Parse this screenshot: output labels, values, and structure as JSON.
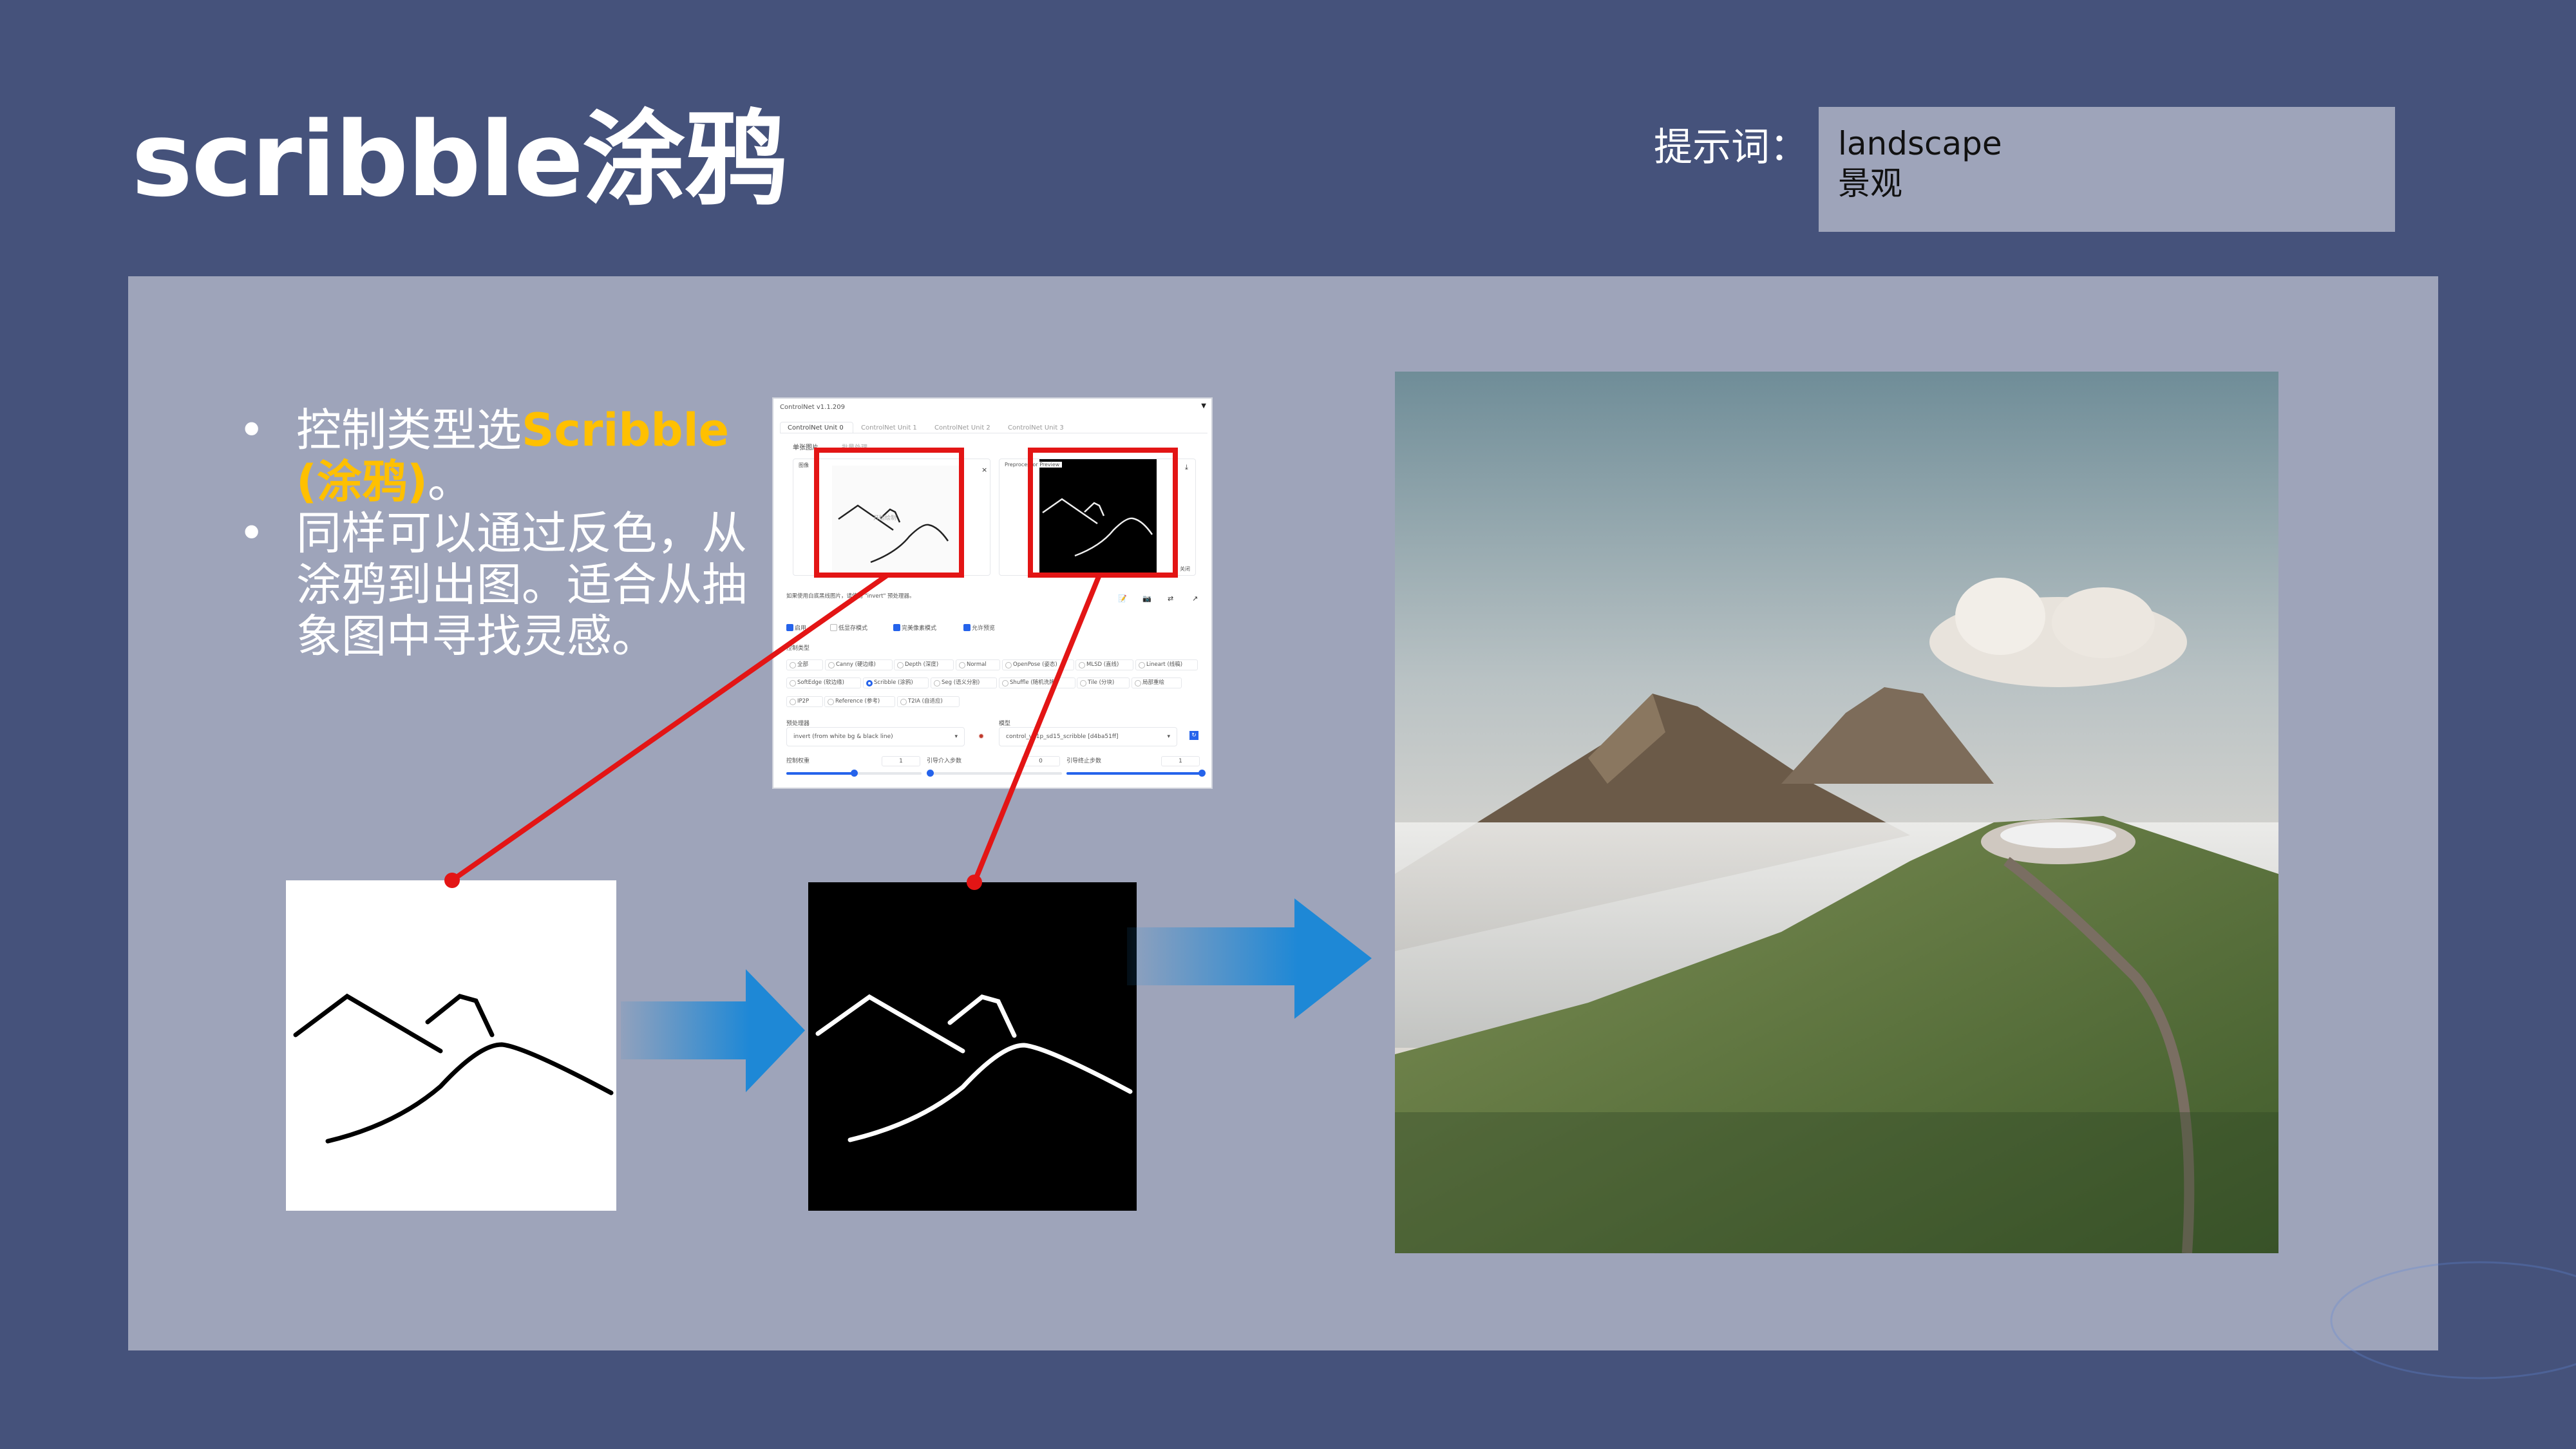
{
  "title": "scribble涂鸦",
  "prompt": {
    "label": "提示词：",
    "line1": "landscape",
    "line2": "景观"
  },
  "bullets": {
    "b1_prefix": "控制类型选",
    "b1_highlight": "Scribble (涂鸦)",
    "b1_suffix": "。",
    "b2": "同样可以通过反色，从涂鸦到出图。适合从抽象图中寻找灵感。",
    "bullet_char": "•"
  },
  "controlnet": {
    "header": "ControlNet v1.1.209",
    "collapse_icon": "▼",
    "tabs": [
      "ControlNet Unit 0",
      "ControlNet Unit 1",
      "ControlNet Unit 2",
      "ControlNet Unit 3"
    ],
    "subtabs": [
      "单张图片",
      "批量处理"
    ],
    "image_label": "图像",
    "canvas_hint": "开始绘制",
    "preview_label": "Preprocessor Preview",
    "close_label": "关闭",
    "hint": "如果使用白底黑线图片，请使用 \"invert\" 预处理器。",
    "checkboxes": [
      {
        "label": "启用",
        "checked": true
      },
      {
        "label": "低显存模式",
        "checked": false
      },
      {
        "label": "完美像素模式",
        "checked": true
      },
      {
        "label": "允许预览",
        "checked": true
      }
    ],
    "control_type_label": "控制类型",
    "control_types": [
      "全部",
      "Canny (硬边缘)",
      "Depth (深度)",
      "Normal",
      "OpenPose (姿态)",
      "MLSD (直线)",
      "Lineart (线稿)",
      "SoftEdge (软边缘)",
      "Scribble (涂鸦)",
      "Seg (语义分割)",
      "Shuffle (随机洗牌)",
      "Tile (分块)",
      "局部重绘",
      "IP2P",
      "Reference (参考)",
      "T2IA (自适应)"
    ],
    "selected_control_type": "Scribble (涂鸦)",
    "preprocessor_label": "预处理器",
    "preprocessor_value": "invert (from white bg & black line)",
    "model_label": "模型",
    "model_value": "control_v11p_sd15_scribble [d4ba51ff]",
    "weight_label": "控制权重",
    "weight_value": "1",
    "start_label": "引导介入步数",
    "start_value": "0",
    "end_label": "引导终止步数",
    "end_value": "1",
    "weight_fraction": 0.5,
    "start_fraction": 0.0,
    "end_fraction": 1.0
  },
  "colors": {
    "background": "#45527b",
    "panel": "#9ea4ba",
    "highlight": "#ffc000",
    "callout": "#e31515",
    "arrow": "#1e88d6"
  }
}
